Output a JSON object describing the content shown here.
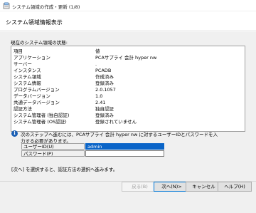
{
  "window": {
    "title": "システム領域の作成・更新 (1/8)"
  },
  "page": {
    "title": "システム領域情報表示"
  },
  "status": {
    "caption": "現在のシステム領域の状態:",
    "rows": [
      {
        "key": "項目",
        "value": "値"
      },
      {
        "key": "アプリケーション",
        "value": "PCAサプライ 会計 hyper nw"
      },
      {
        "key": "サーバー",
        "value": "."
      },
      {
        "key": "インスタンス",
        "value": "PCADB"
      },
      {
        "key": "システム領域",
        "value": "作成済み"
      },
      {
        "key": "システム情報",
        "value": "登録済み"
      },
      {
        "key": "プログラムバージョン",
        "value": "2.0.1057"
      },
      {
        "key": "データバージョン",
        "value": "1.0"
      },
      {
        "key": "共通データバージョン",
        "value": "2.41"
      },
      {
        "key": "認証方法",
        "value": "独自認証"
      },
      {
        "key": "システム管理者 (独自認証)",
        "value": "登録済み"
      },
      {
        "key": "システム管理者 (OS認証)",
        "value": "登録されていません"
      }
    ]
  },
  "info": {
    "line1": "次のステップへ進むには、PCAサプライ 会計 hyper nw に対するユーザーIDとパスワードを入",
    "line2": "力する必要があります。"
  },
  "credentials": {
    "user_label": "ユーザーID(U)",
    "user_value": "admin",
    "password_label": "パスワード(P)",
    "password_value": ""
  },
  "hint": "[次へ] を選択すると、認証方法の選択へ進みます。",
  "buttons": {
    "back": "戻る(B)",
    "next": "次へ(N)>",
    "cancel": "キャンセル",
    "help": "ヘルプ(H)"
  }
}
